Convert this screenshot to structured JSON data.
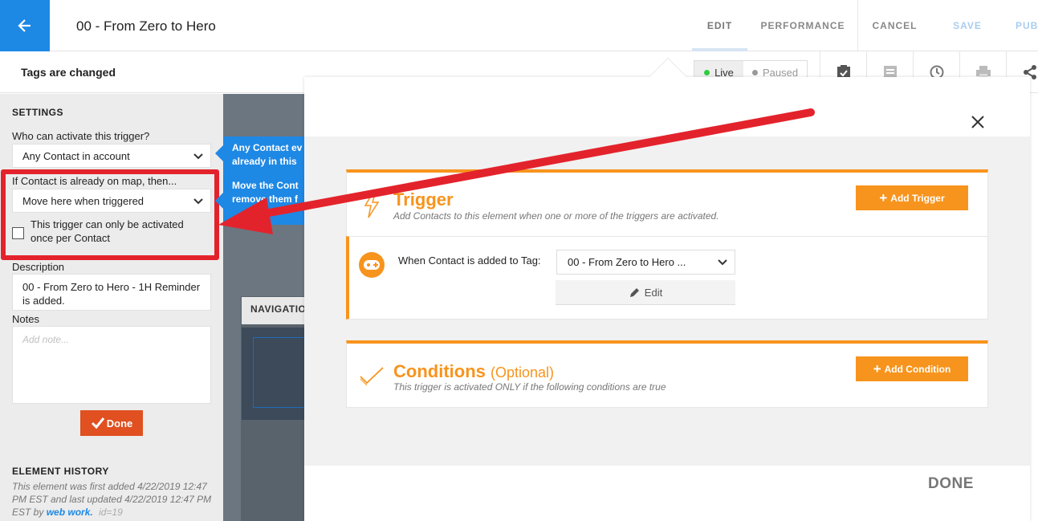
{
  "header": {
    "title": "00 - From Zero to Hero",
    "nav": {
      "edit": "EDIT",
      "performance": "PERFORMANCE",
      "cancel": "CANCEL",
      "save": "SAVE",
      "publish": "PUB"
    }
  },
  "subheader": {
    "title": "Tags are changed",
    "status": {
      "live": "Live",
      "paused": "Paused",
      "live_color": "#2ecc40",
      "paused_color": "#999999"
    },
    "tools": [
      "clipboard-check-icon",
      "notes-icon",
      "history-icon",
      "print-icon",
      "share-icon"
    ]
  },
  "settings": {
    "heading": "SETTINGS",
    "who_label": "Who can activate this trigger?",
    "who_value": "Any Contact in account",
    "if_label": "If Contact is already on map, then...",
    "if_value": "Move here when triggered",
    "once_label": "This trigger can only be activated once per Contact",
    "once_checked": false,
    "description_label": "Description",
    "description_value": "00 - From Zero to Hero - 1H Reminder is added.",
    "notes_label": "Notes",
    "notes_placeholder": "Add note...",
    "done_label": "Done"
  },
  "history": {
    "heading": "ELEMENT HISTORY",
    "text": "This element was first added 4/22/2019 12:47 PM EST and last updated 4/22/2019 12:47 PM EST by",
    "user": "web work.",
    "id": "id=19"
  },
  "tooltip": {
    "line1": "Any Contact ev",
    "line2": "already in this",
    "line3": "Move the Cont",
    "line4": "remove them f"
  },
  "canvas": {
    "nav_card_title": "NAVIGATION"
  },
  "modal": {
    "trigger": {
      "title": "Trigger",
      "subtitle": "Add Contacts to this element when one or more of the triggers are activated.",
      "add_button": "Add Trigger",
      "row_label": "When Contact is added to Tag:",
      "tag_value": "00 - From Zero to Hero ...",
      "edit_label": "Edit"
    },
    "conditions": {
      "title": "Conditions",
      "optional": "(Optional)",
      "subtitle": "This trigger is activated ONLY if the following conditions are true",
      "add_button": "Add Condition"
    },
    "done_label": "DONE"
  },
  "colors": {
    "accent": "#1e88e5",
    "orange": "#f7941d",
    "highlight_red": "#e3232c",
    "done_red": "#e05020"
  }
}
